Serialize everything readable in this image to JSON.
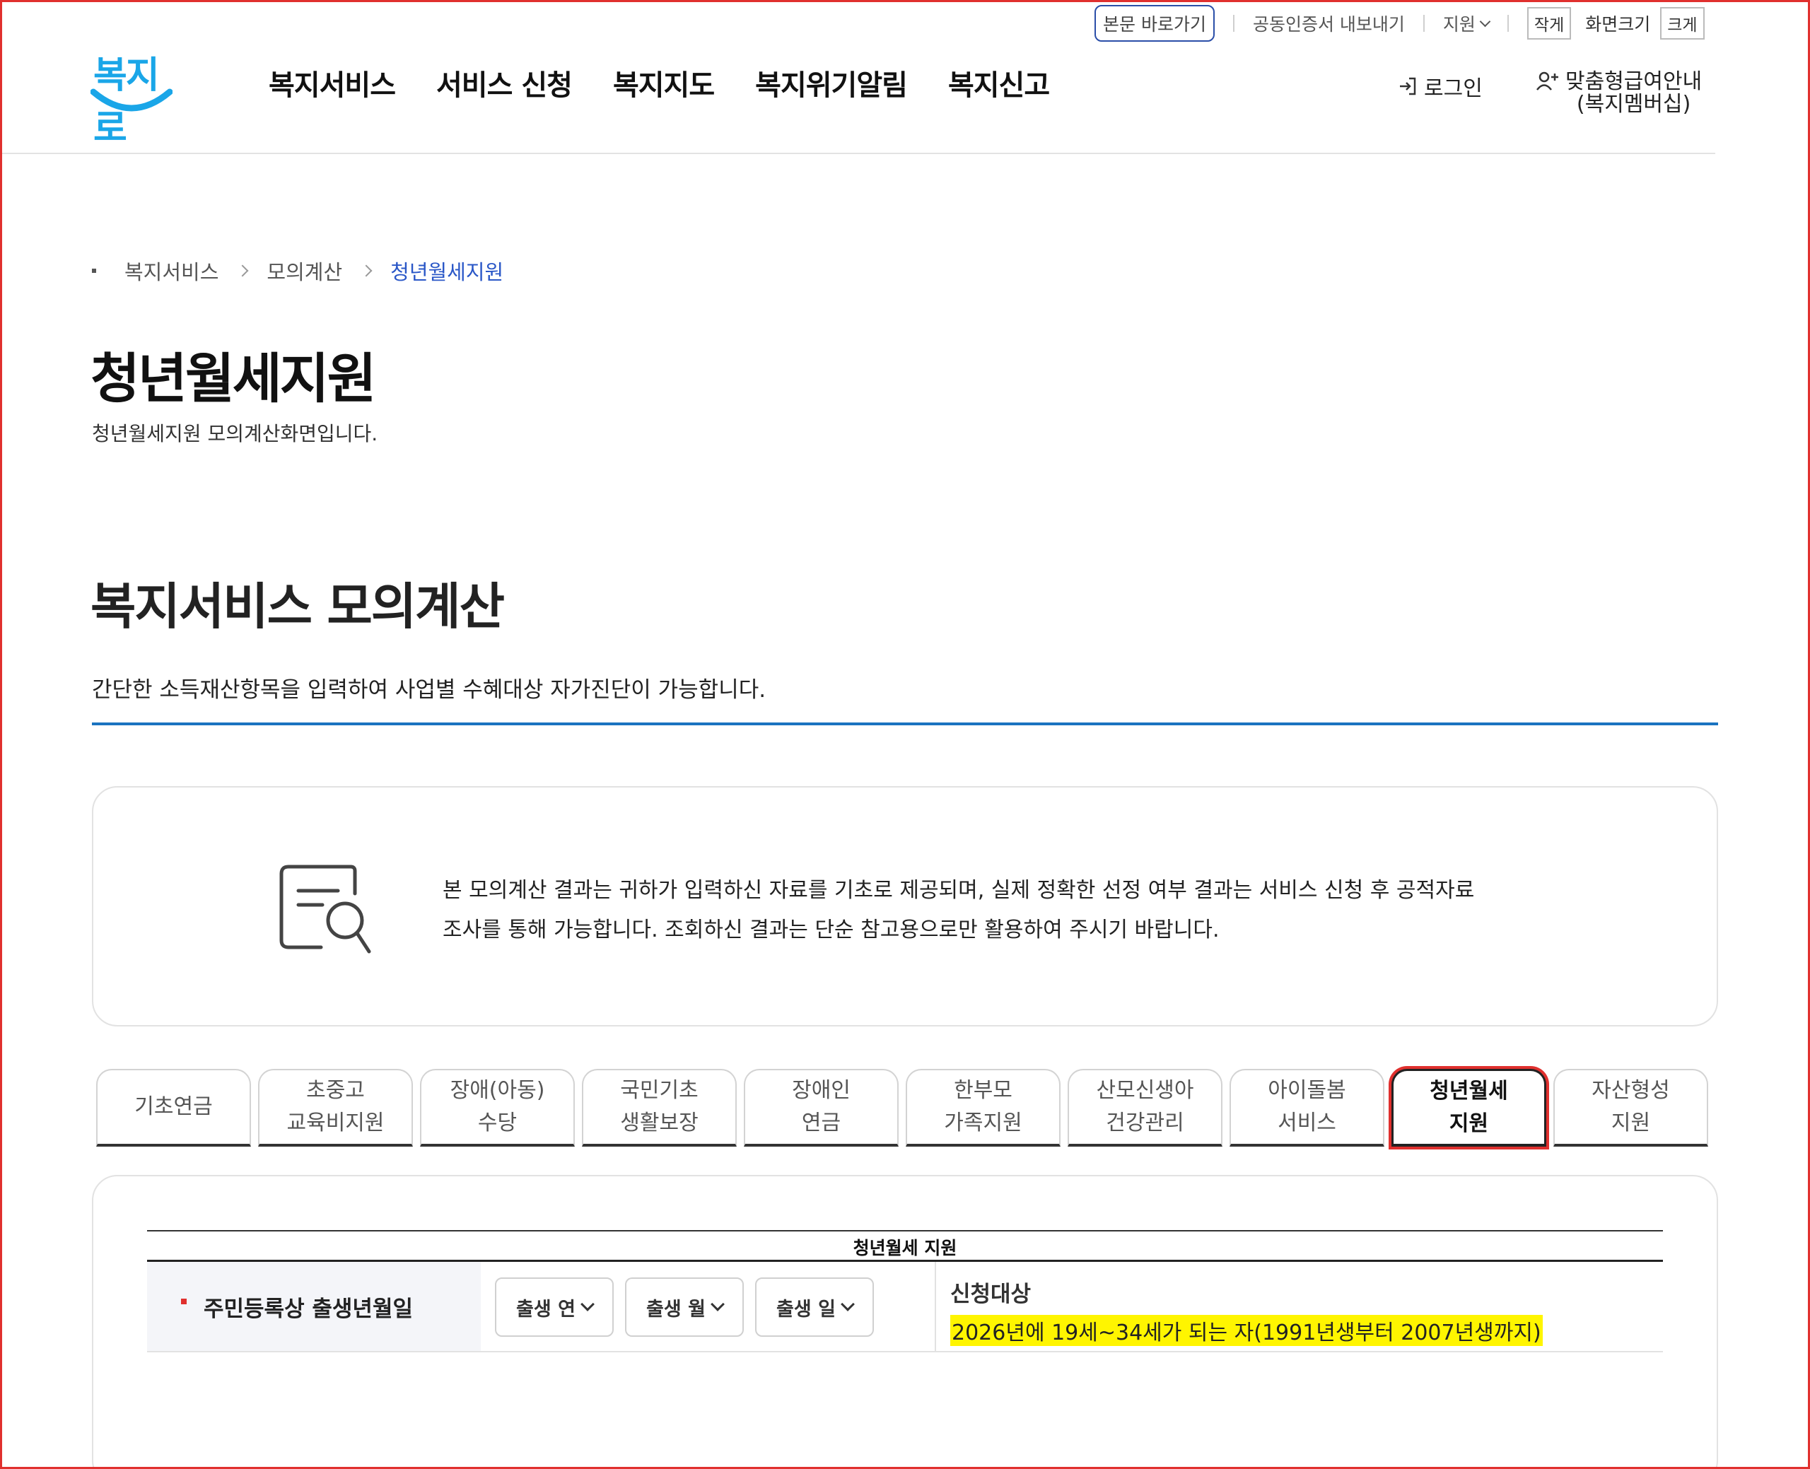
{
  "utility": {
    "skip_link": "본문 바로가기",
    "cert_export": "공동인증서 내보내기",
    "language": "지원",
    "font_small": "작게",
    "font_label": "화면크기",
    "font_large": "크게"
  },
  "header": {
    "logo_text": "복지로",
    "nav": [
      "복지서비스",
      "서비스 신청",
      "복지지도",
      "복지위기알림",
      "복지신고"
    ],
    "login": "로그인",
    "member_line1": "맞춤형급여안내",
    "member_line2": "(복지멤버십)"
  },
  "breadcrumb": {
    "items": [
      "복지서비스",
      "모의계산",
      "청년월세지원"
    ]
  },
  "page": {
    "title": "청년월세지원",
    "description": "청년월세지원 모의계산화면입니다."
  },
  "section": {
    "title": "복지서비스 모의계산",
    "description": "간단한 소득재산항목을 입력하여 사업별 수혜대상 자가진단이 가능합니다."
  },
  "notice": {
    "icon": "document-search-icon",
    "line1": "본 모의계산 결과는 귀하가 입력하신 자료를 기초로 제공되며, 실제 정확한 선정 여부 결과는 서비스 신청 후 공적자료",
    "line2": "조사를 통해 가능합니다. 조회하신 결과는 단순 참고용으로만 활용하여 주시기 바랍니다."
  },
  "tabs": [
    {
      "line1": "기초연금",
      "line2": ""
    },
    {
      "line1": "초중고",
      "line2": "교육비지원"
    },
    {
      "line1": "장애(아동)",
      "line2": "수당"
    },
    {
      "line1": "국민기초",
      "line2": "생활보장"
    },
    {
      "line1": "장애인",
      "line2": "연금"
    },
    {
      "line1": "한부모",
      "line2": "가족지원"
    },
    {
      "line1": "산모신생아",
      "line2": "건강관리"
    },
    {
      "line1": "아이돌봄",
      "line2": "서비스"
    },
    {
      "line1": "청년월세",
      "line2": "지원"
    },
    {
      "line1": "자산형성",
      "line2": "지원"
    }
  ],
  "active_tab": 8,
  "form": {
    "caption": "청년월세 지원",
    "birth_label": "주민등록상 출생년월일",
    "select_year": "출생 연",
    "select_month": "출생 월",
    "select_day": "출생 일",
    "eligibility_title": "신청대상",
    "eligibility_text": "2026년에 19세~34세가 되는 자(1991년생부터 2007년생까지)"
  },
  "colors": {
    "accent_blue": "#1a73c0",
    "link_blue": "#2a57c7",
    "highlight": "#fff500",
    "required_red": "#e0302e"
  }
}
